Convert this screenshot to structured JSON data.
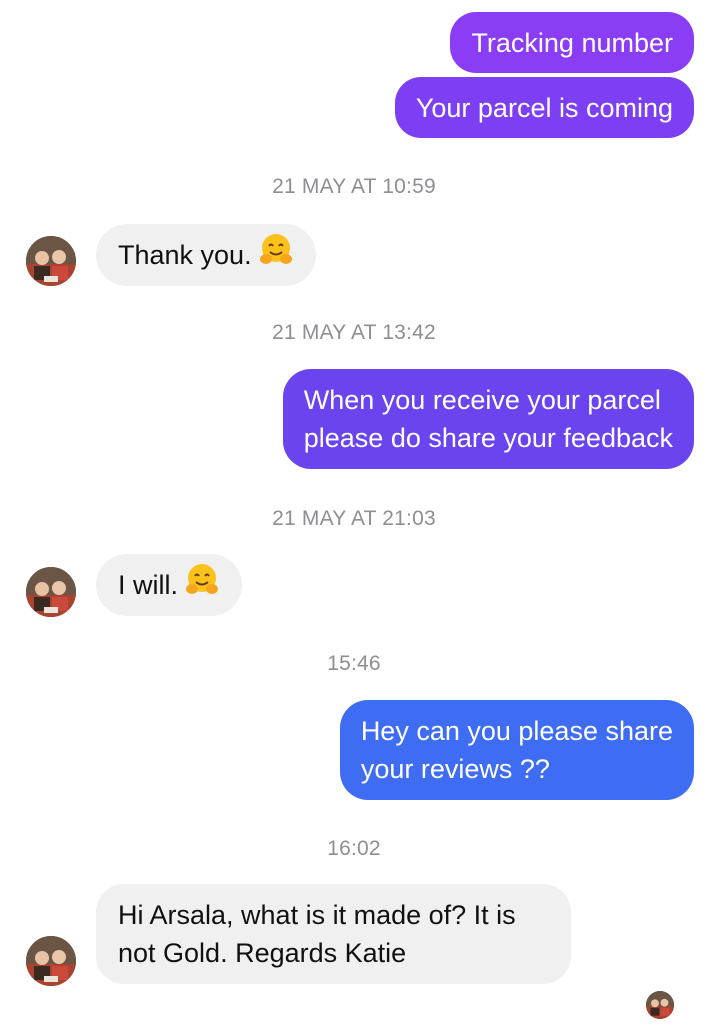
{
  "conversation": {
    "messages": [
      {
        "direction": "outgoing",
        "text": "Tracking number",
        "color": "#8a3df5"
      },
      {
        "direction": "outgoing",
        "text": "Your parcel is coming",
        "color": "#7d3ff3"
      },
      {
        "type": "timestamp",
        "text": "21 MAY AT 10:59"
      },
      {
        "direction": "incoming",
        "text": "Thank you.",
        "emoji": "hugging-face-emoji"
      },
      {
        "type": "timestamp",
        "text": "21 MAY AT 13:42"
      },
      {
        "direction": "outgoing",
        "lines": [
          "When you receive your parcel",
          "please do share your feedback"
        ],
        "color": "#6a44ef"
      },
      {
        "type": "timestamp",
        "text": "21 MAY AT 21:03"
      },
      {
        "direction": "incoming",
        "text": "I will.",
        "emoji": "hugging-face-emoji"
      },
      {
        "type": "timestamp",
        "text": "15:46"
      },
      {
        "direction": "outgoing",
        "lines": [
          "Hey can you please share",
          "your reviews ??"
        ],
        "color": "#3e6cf3"
      },
      {
        "type": "timestamp",
        "text": "16:02"
      },
      {
        "direction": "incoming",
        "lines": [
          "Hi Arsala, what is it made of? It is",
          "not  Gold. Regards Katie"
        ]
      }
    ]
  },
  "colors": {
    "incoming_bubble": "#f0f0f0",
    "timestamp_text": "#8e8e93"
  },
  "icons": {
    "contact_avatar": "contact-avatar",
    "seen_avatar": "read-receipt-avatar",
    "emoji": "hugging-face-emoji"
  }
}
